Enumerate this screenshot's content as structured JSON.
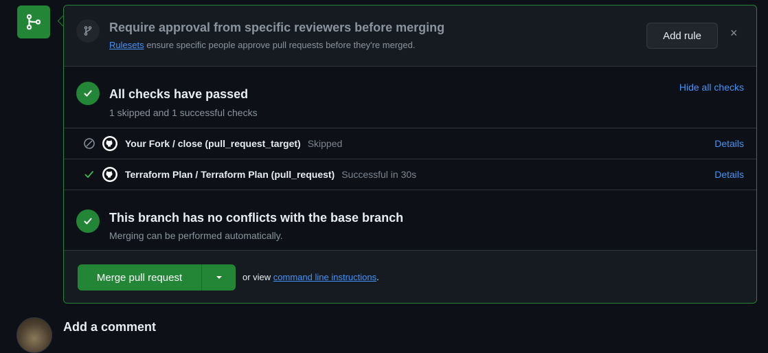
{
  "rule_banner": {
    "title": "Require approval from specific reviewers before merging",
    "link_text": "Rulesets",
    "description_rest": " ensure specific people approve pull requests before they're merged.",
    "add_rule_label": "Add rule",
    "close_symbol": "×",
    "icon": "git-branch-icon"
  },
  "checks": {
    "title": "All checks have passed",
    "subtitle": "1 skipped and 1 successful checks",
    "hide_label": "Hide all checks",
    "rows": [
      {
        "name": "Your Fork / close (pull_request_target)",
        "status": "Skipped",
        "status_icon": "skipped-icon",
        "details_label": "Details"
      },
      {
        "name": "Terraform Plan / Terraform Plan (pull_request)",
        "status": "Successful in 30s",
        "status_icon": "check-icon",
        "details_label": "Details"
      }
    ]
  },
  "conflicts": {
    "title": "This branch has no conflicts with the base branch",
    "subtitle": "Merging can be performed automatically."
  },
  "merge": {
    "button_label": "Merge pull request",
    "or_view": "or view ",
    "cli_link": "command line instructions",
    "period": "."
  },
  "comment": {
    "title": "Add a comment"
  },
  "colors": {
    "success": "#238636",
    "link": "#4493f8",
    "background": "#0d1117",
    "panel": "#161b22",
    "border": "#30363d"
  }
}
